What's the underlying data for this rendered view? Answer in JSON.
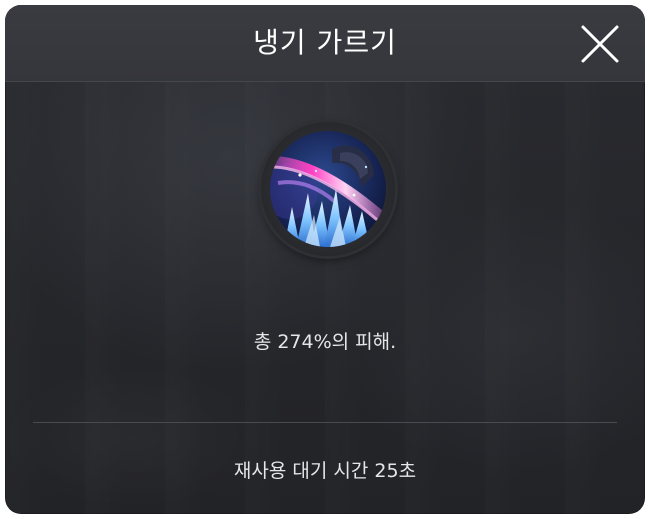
{
  "dialog": {
    "title": "냉기 가르기",
    "close_icon": "close-icon"
  },
  "skill": {
    "icon": "ice-slash-skill-icon",
    "description": "총 274%의 피해.",
    "cooldown": "재사용 대기 시간 25초"
  },
  "colors": {
    "background": "#26272b",
    "header": "#38393e",
    "text": "#e6e6e8",
    "title": "#ffffff"
  }
}
